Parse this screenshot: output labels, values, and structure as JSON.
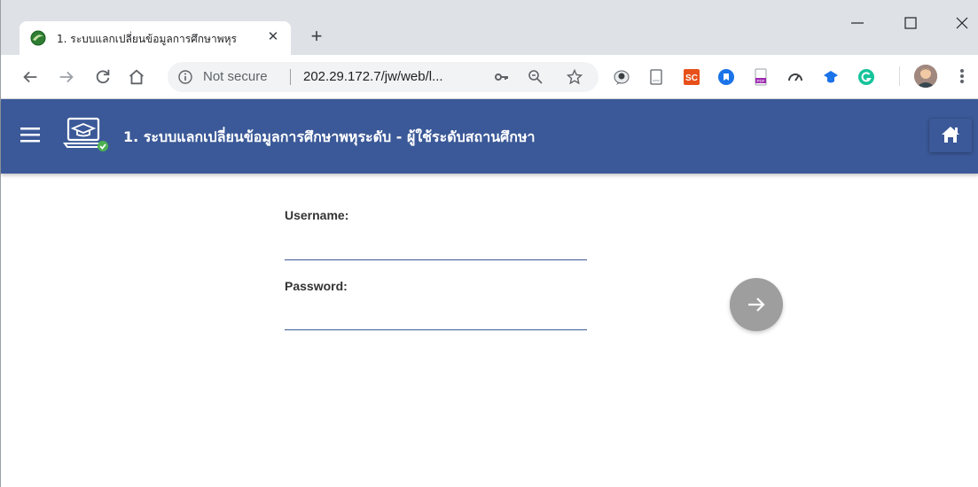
{
  "browser": {
    "tab": {
      "title": "1. ระบบแลกเปลี่ยนข้อมูลการศึกษาพหุร",
      "close_glyph": "✕"
    },
    "new_tab_glyph": "+",
    "window_controls": {
      "minimize": "—",
      "maximize": "☐",
      "close": "✕"
    },
    "omnibox": {
      "security_text": "Not secure",
      "url": "202.29.172.7/jw/web/l..."
    },
    "extensions": [
      "reading-icon",
      "page-icon",
      "sc-extension-icon",
      "shield-extension-icon",
      "pdf-extension-icon",
      "speed-icon",
      "cap-extension-icon",
      "grammarly-icon"
    ]
  },
  "app": {
    "header_color": "#3b5998",
    "title": "1. ระบบแลกเปลี่ยนข้อมูลการศึกษาพหุระดับ - ผู้ใช้ระดับสถานศึกษา",
    "icons": {
      "menu": "menu-icon",
      "logo": "laptop-graduation-icon",
      "home": "home-icon"
    }
  },
  "login_form": {
    "username_label": "Username:",
    "username_value": "",
    "password_label": "Password:",
    "password_value": "",
    "submit_icon": "arrow-right-icon"
  }
}
